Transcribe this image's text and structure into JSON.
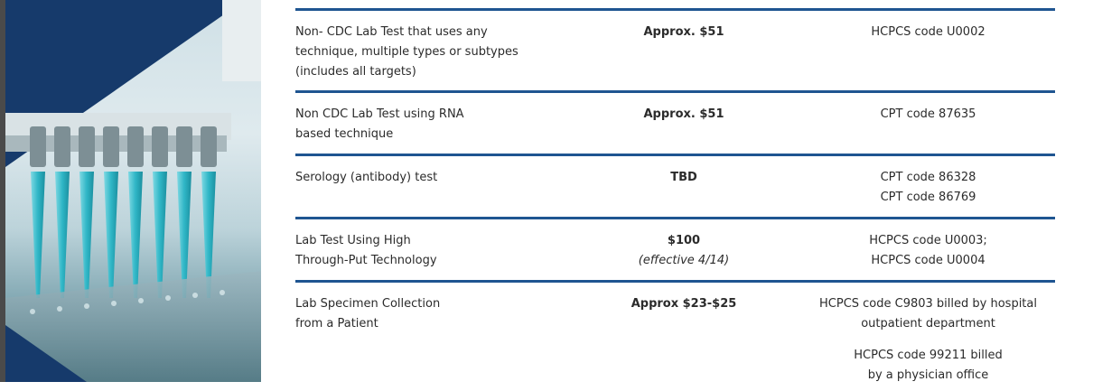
{
  "rows": [
    {
      "test": [
        "Non- CDC Lab Test that uses any",
        "technique, multiple types or subtypes",
        "(includes all targets)"
      ],
      "price": [
        "Approx. $51"
      ],
      "code": [
        "HCPCS code U0002"
      ]
    },
    {
      "test": [
        "Non CDC Lab Test using RNA",
        "based technique"
      ],
      "price": [
        "Approx. $51"
      ],
      "code": [
        "CPT code 87635"
      ]
    },
    {
      "test": [
        "Serology (antibody) test"
      ],
      "price": [
        "TBD"
      ],
      "code": [
        "CPT code 86328",
        "CPT code 86769"
      ]
    },
    {
      "test": [
        "Lab Test Using High",
        "Through-Put Technology"
      ],
      "price": [
        "$100"
      ],
      "price_note": "(effective 4/14)",
      "code": [
        "HCPCS  code U0003;",
        "HCPCS code U0004"
      ]
    },
    {
      "test": [
        "Lab Specimen Collection",
        "from a Patient"
      ],
      "price": [
        "Approx $23-$25"
      ],
      "code": [
        "HCPCS code C9803 billed by hospital",
        "outpatient department"
      ],
      "code_extra": [
        "HCPCS code 99211 billed",
        "by a physician office"
      ]
    }
  ],
  "colors": {
    "rule": "#1f5591",
    "text": "#2b2b2b",
    "liquid": "#2fb6c6"
  },
  "icons": {
    "photo": "lab-pipette-photo"
  }
}
